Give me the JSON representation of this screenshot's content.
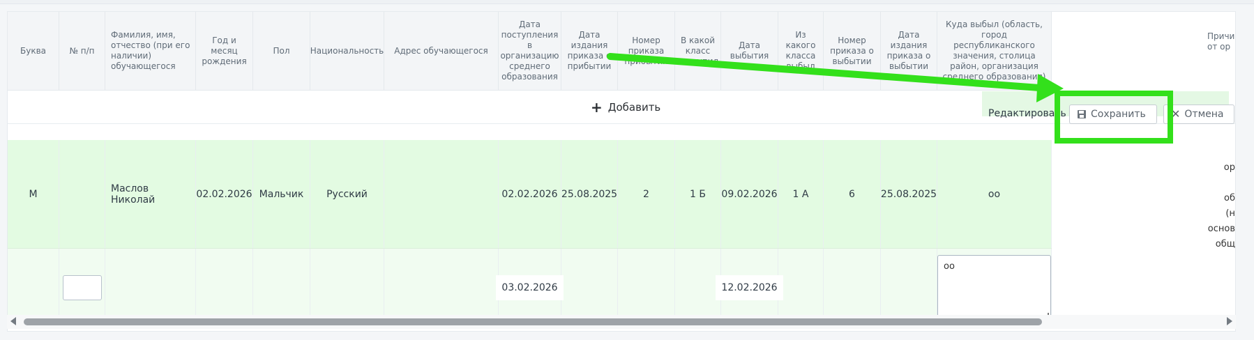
{
  "colors": {
    "highlight": "#33e01b",
    "row_selected": "#e3fbe2",
    "row_edit": "#f1fcf1",
    "edit_bar": "#e4f8e4"
  },
  "table": {
    "headers": [
      "Буква",
      "№ п/п",
      "Фамилия, имя, отчество (при его наличии) обучающегося",
      "Год и месяц рождения",
      "Пол",
      "Национальность",
      "Адрес обучающегося",
      "Дата поступления в организацию среднего образования",
      "Дата издания приказа о прибытии",
      "Номер приказа прибытия",
      "В какой класс поступил",
      "Дата выбытия",
      "Из какого класса выбыл",
      "Номер приказа о выбытии",
      "Дата издания приказа о выбытии",
      "Куда выбыл (область, город республиканского значения, столица район, организация среднего образования)",
      "Причины от ор"
    ],
    "rows": [
      {
        "cells": [
          "М",
          "",
          "Маслов Николай",
          "02.02.2026",
          "Мальчик",
          "Русский",
          "",
          "02.02.2026",
          "25.08.2025",
          "2",
          "1 Б",
          "09.02.2026",
          "1 А",
          "6",
          "25.08.2025",
          "оо"
        ],
        "partial_last": "ор\n\nоб\n(н\nоснов\nобщ"
      }
    ],
    "edit_row": {
      "date_in": "03.02.2026",
      "date_out": "12.02.2026",
      "destination": "оо",
      "number_placeholder": ""
    }
  },
  "add_button": {
    "icon": "plus-icon",
    "label": "Добавить"
  },
  "edit_bar": {
    "label": "Редактировать",
    "save_icon": "floppy-disk-icon",
    "save_label": "Сохранить",
    "cancel_icon": "close-icon",
    "cancel_label": "Отмена"
  }
}
